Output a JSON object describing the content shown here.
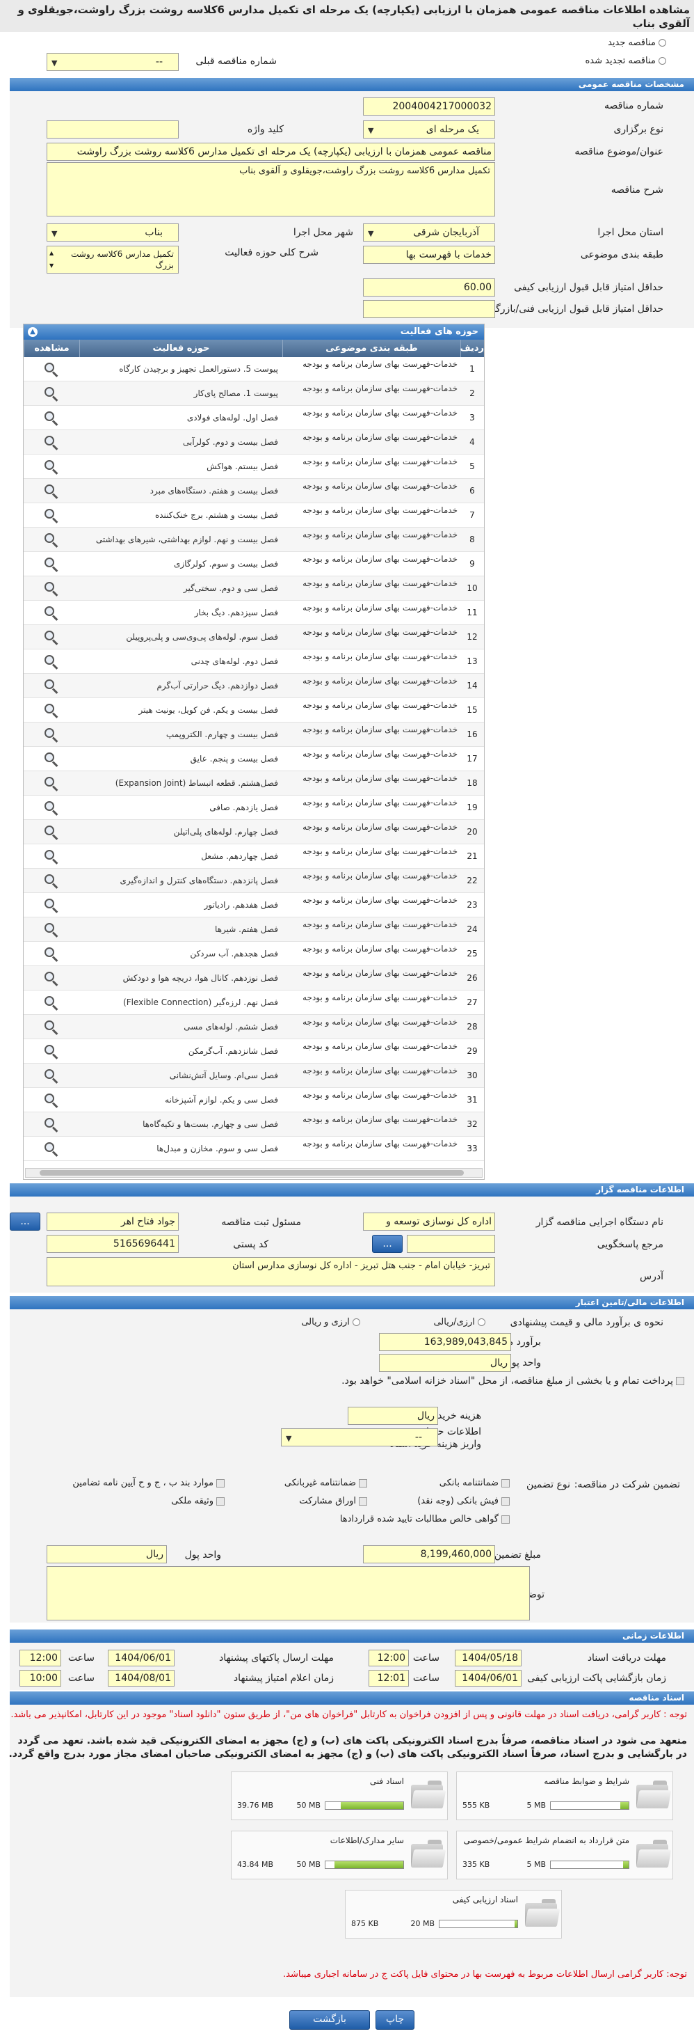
{
  "header": {
    "title": "مشاهده اطلاعات مناقصه عمومی همزمان با ارزیابی (یکپارچه) یک مرحله ای تکمیل مدارس 6کلاسه روشت بزرگ راوشت،جویقلوی و آلقوی بناب"
  },
  "top": {
    "new_label": "مناقصه جدید",
    "renewed_label": "مناقصه تجدید شده",
    "prev_label": "شماره مناقصه قبلی",
    "prev_value": "--"
  },
  "sections": {
    "general": "مشخصات مناقصه عمومی",
    "organizer": "اطلاعات مناقصه گزار",
    "financial": "اطلاعات مالی/تامین اعتبار",
    "timing": "اطلاعات زمانی",
    "docs": "اسناد مناقصه"
  },
  "general": {
    "number_label": "شماره مناقصه",
    "number": "2004004217000032",
    "method_label": "نوع برگزاری",
    "method": "یک مرحله ای",
    "keyword_label": "کلید واژه",
    "keyword": "",
    "subject_label": "عنوان/موضوع مناقصه",
    "subject": "مناقصه عمومی همزمان با ارزیابی (یکپارچه) یک مرحله ای تکمیل مدارس 6کلاسه روشت بزرگ راوشت",
    "desc_label": "شرح مناقصه",
    "desc": "تکمیل مدارس 6کلاسه روشت بزرگ راوشت،جویقلوی و آلقوی بناب",
    "province_label": "استان محل اجرا",
    "province": "آذربایجان شرقی",
    "city_label": "شهر محل اجرا",
    "city": "بناب",
    "category_label": "طبقه بندی موضوعی",
    "category": "خدمات با فهرست بها",
    "scope_label": "شرح کلی حوزه فعالیت",
    "scope": "تکمیل مدارس 6کلاسه روشت بزرگ",
    "min_quality_label": "حداقل امتیاز قابل قبول ارزیابی کیفی",
    "min_quality": "60.00",
    "min_tech_label": "حداقل امتیاز قابل قبول ارزیابی فنی/بازرگانی",
    "min_tech": ""
  },
  "activities": {
    "title": "حوزه های فعالیت",
    "columns": {
      "no": "ردیف",
      "category": "طبقه بندی موضوعی",
      "activity": "حوزه فعالیت",
      "view": "مشاهده"
    },
    "category_text": "خدمات-فهرست بهای سازمان برنامه و بودجه",
    "rows": [
      {
        "no": "1",
        "activity": "پیوست 5. دستورالعمل تجهیز و برچیدن کارگاه"
      },
      {
        "no": "2",
        "activity": "پیوست 1. مصالح پای‌کار"
      },
      {
        "no": "3",
        "activity": "فصل اول. لوله‌های فولادی"
      },
      {
        "no": "4",
        "activity": "فصل بیست و دوم. کولرآبی"
      },
      {
        "no": "5",
        "activity": "فصل بیستم. هواکش"
      },
      {
        "no": "6",
        "activity": "فصل بیست و هفتم. دستگاه‌های مبرد"
      },
      {
        "no": "7",
        "activity": "فصل بیست و هشتم. برج خنک‌کننده"
      },
      {
        "no": "8",
        "activity": "فصل بیست و نهم. لوازم بهداشتی، شیرهای بهداشتی"
      },
      {
        "no": "9",
        "activity": "فصل بیست و سوم. کولرگازی"
      },
      {
        "no": "10",
        "activity": "فصل سی و دوم. سختی‌گیر"
      },
      {
        "no": "11",
        "activity": "فصل سیزدهم. دیگ بخار"
      },
      {
        "no": "12",
        "activity": "فصل سوم. لوله‌های پی‌وی‌سی و پلی‌پروپیلن"
      },
      {
        "no": "13",
        "activity": "فصل دوم. لوله‌های چدنی"
      },
      {
        "no": "14",
        "activity": "فصل دوازدهم. دیگ حرارتی آب‌گرم"
      },
      {
        "no": "15",
        "activity": "فصل بیست و یکم. فن کویل، یونیت هیتر"
      },
      {
        "no": "16",
        "activity": "فصل بیست و چهارم. الکتروپمپ"
      },
      {
        "no": "17",
        "activity": "فصل بیست و پنجم. عایق"
      },
      {
        "no": "18",
        "activity": "فصل‌هشتم. قطعه انبساط (Expansion Joint)"
      },
      {
        "no": "19",
        "activity": "فصل یازدهم. صافی"
      },
      {
        "no": "20",
        "activity": "فصل چهارم. لوله‌های پلی‌اتیلن"
      },
      {
        "no": "21",
        "activity": "فصل چهاردهم. مشعل"
      },
      {
        "no": "22",
        "activity": "فصل پانزدهم. دستگاه‌های کنترل و اندازه‌گیری"
      },
      {
        "no": "23",
        "activity": "فصل هفدهم. رادیاتور"
      },
      {
        "no": "24",
        "activity": "فصل هفتم. شیرها"
      },
      {
        "no": "25",
        "activity": "فصل هجدهم. آب سردکن"
      },
      {
        "no": "26",
        "activity": "فصل نوزدهم. کانال هوا، دریچه هوا و دودکش"
      },
      {
        "no": "27",
        "activity": "فصل نهم. لرزه‌گیر (Flexible Connection)"
      },
      {
        "no": "28",
        "activity": "فصل ششم. لوله‌های مسی"
      },
      {
        "no": "29",
        "activity": "فصل شانزدهم. آب‌گرمکن"
      },
      {
        "no": "30",
        "activity": "فصل سی‌ام. وسایل آتش‌نشانی"
      },
      {
        "no": "31",
        "activity": "فصل سی و یکم. لوازم آشپزخانه"
      },
      {
        "no": "32",
        "activity": "فصل سی و چهارم. بست‌ها و تکیه‌گاه‌ها"
      },
      {
        "no": "33",
        "activity": "فصل سی و سوم. مخازن و مبدل‌ها"
      }
    ]
  },
  "organizer": {
    "name_label": "نام دستگاه اجرایی مناقصه گزار",
    "name": "اداره کل نوسازی  توسعه و",
    "official_label": "مسئول ثبت مناقصه",
    "official": "جواد فتاح اهر",
    "ref_label": "مرجع پاسخگویی",
    "ref": "",
    "postal_label": "کد پستی",
    "postal": "5165696441",
    "address_label": "آدرس",
    "address": "تبریز- خیابان امام - جنب هتل تبریز - اداره کل نوسازی مدارس استان",
    "dots": "...",
    "ellipsis": "..."
  },
  "financial": {
    "estimate_method_label": "نحوه ی برآورد مالی و قیمت پیشنهادی",
    "opt_currency": "ارزی/ریالی",
    "opt_both": "ارزی و ریالی",
    "estimate_label": "برآورد مالی",
    "estimate": "163,989,043,845",
    "unit_label": "واحد پول",
    "unit": "ریال",
    "payment_text": "پرداخت تمام و یا بخشی از مبلغ مناقصه، از محل \"اسناد خزانه اسلامی\" خواهد بود.",
    "doc_fee_label": "هزینه خرید اسناد",
    "doc_fee_unit": "ریال",
    "account_label": "اطلاعات حساب جهت واریز هزینه خرید اسناد",
    "account": "--",
    "guarantee_title": "تضمین شرکت در مناقصه:",
    "guarantee_type": "نوع تضمین",
    "g1": "ضمانتنامه بانکی",
    "g2": "ضمانتنامه غیربانکی",
    "g3": "موارد بند ب ، ج و ح آیین نامه تضامین",
    "g4": "فیش بانکی (وجه نقد)",
    "g5": "اوراق مشارکت",
    "g6": "وثیقه ملکی",
    "g7": "گواهی خالص مطالبات تایید شده قراردادها",
    "amount_label": "مبلغ تضمین",
    "amount": "8,199,460,000",
    "amount_unit_label": "واحد پول",
    "amount_unit": "ریال",
    "notes_label": "توضیحات",
    "notes": ""
  },
  "timing": {
    "receive_label": "مهلت دریافت اسناد",
    "receive_date": "1404/05/18",
    "receive_time": "12:00",
    "send_label": "مهلت ارسال پاکتهای پیشنهاد",
    "send_date": "1404/06/01",
    "send_time": "12:00",
    "quality_label": "زمان بازگشایی پاکت ارزیابی کیفی",
    "quality_date": "1404/06/01",
    "quality_time": "12:01",
    "maxscore_label": "زمان اعلام امتیاز پیشنهاد",
    "maxscore_date": "1404/08/01",
    "maxscore_time": "10:00",
    "time_label": "ساعت"
  },
  "docs": {
    "note1": "توجه : کاربر گرامی، دریافت اسناد در مهلت قانونی و پس از افزودن فراخوان به کارتابل \"فراخوان های من\"، از طریق ستون \"دانلود اسناد\" موجود در این کارتابل، امکانپذیر می باشد.",
    "note2": "متعهد می شود در اسناد مناقصه، صرفاً بدرج اسناد الکترونیکی پاکت های (ب) و (ج) مجهز به امضای الکترونیکی قید شده باشد. تعهد می گردد در بارگشایی و بدرج اسناد، صرفاً اسناد الکترونیکی پاکت های (ب) و (ج) مجهز به امضای الکترونیکی صاحبان امضای مجاز مورد بدرج واقع گردد.",
    "items": [
      {
        "title": "شرایط و ضوابط مناقصه",
        "current": "555 KB",
        "max": "5 MB",
        "fill": 0.11
      },
      {
        "title": "اسناد فنی",
        "current": "39.76 MB",
        "max": "50 MB",
        "fill": 0.8
      },
      {
        "title": "متن قرارداد به انضمام شرایط عمومی/خصوصی",
        "current": "335 KB",
        "max": "5 MB",
        "fill": 0.07
      },
      {
        "title": "سایر مدارک/اطلاعات",
        "current": "43.84 MB",
        "max": "50 MB",
        "fill": 0.88
      },
      {
        "title": "اسناد ارزیابی کیفی",
        "current": "875 KB",
        "max": "20 MB",
        "fill": 0.04
      }
    ],
    "note3": "توجه: کاربر گرامی ارسال اطلاعات مربوط به فهرست بها در محتوای فایل پاکت ج در سامانه اجباری میباشد."
  },
  "actions": {
    "print": "چاپ",
    "back": "بازگشت"
  }
}
